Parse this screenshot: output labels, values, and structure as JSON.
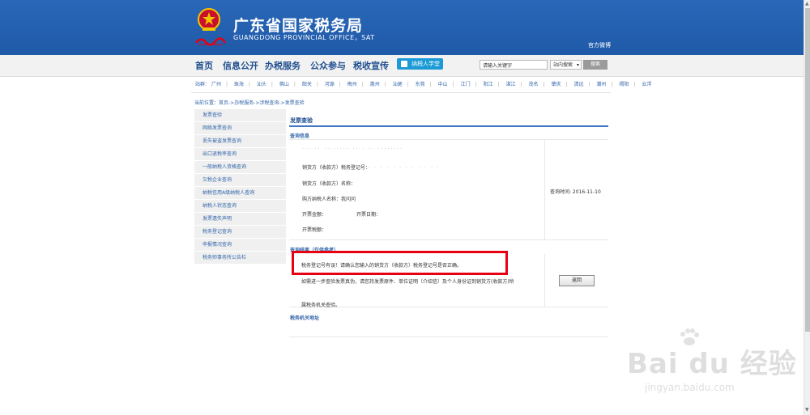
{
  "header": {
    "title_cn": "广东省国家税务局",
    "title_en": "GUANGDONG PROVINCIAL OFFICE，SAT",
    "weibo": "官方微博",
    "colors": {
      "header_bg": "#1f5aa8",
      "accent": "#3f77c0",
      "highlight": "#e60012"
    }
  },
  "nav": {
    "items": [
      "首页",
      "信息公开",
      "办税服务",
      "公众参与",
      "税收宣传"
    ],
    "classroom": "纳税人学堂",
    "search_placeholder": "请输入关键字",
    "search_scope": "站内搜索",
    "search_button": "搜索"
  },
  "cities": {
    "label": "站群：",
    "items": [
      "广州",
      "珠海",
      "汕头",
      "佛山",
      "韶关",
      "河源",
      "梅州",
      "惠州",
      "汕尾",
      "东莞",
      "中山",
      "江门",
      "阳江",
      "湛江",
      "茂名",
      "肇庆",
      "清远",
      "潮州",
      "揭阳",
      "云浮"
    ]
  },
  "breadcrumb": "当前位置：首页->办税服务->涉税查询->发票查验",
  "sidebar": {
    "items": [
      "发票查验",
      "网络发票查询",
      "丢失被盗发票查询",
      "出口退税率查询",
      "一般纳税人资格查询",
      "欠税企业查询",
      "纳税信用A级纳税人查询",
      "纳税人状态查询",
      "发票遗失声明",
      "税务登记查询",
      "申报情况查询",
      "税务师事务所公告栏"
    ]
  },
  "main": {
    "title": "发票查验",
    "query_section": "查询信息",
    "info": {
      "masked_top": "··· ·· ········  ·· · ··  ········",
      "seller_reg": "销货方（收款方）税务登记号：",
      "seller_reg_value": "· · · · · · · · · · · ·",
      "seller_name": "销货方（收款方）名称：",
      "buyer_name": "购方纳税人名称：我问问",
      "amount": "开票金额：",
      "date": "开票日期：",
      "tax": "开票税额："
    },
    "query_time": "查询时间: 2016-11-10",
    "result_section": "查询结果（仅供参考）",
    "error": "税务登记号有误！请确认您输入的销货方（收款方）税务登记号是否正确。",
    "advice": "如需进一步查验发票真伪，请您持发票原件、单位证明（介绍信）及个人身份证到销货方(收款方)所",
    "advice_2": "属税务机关查验。",
    "back_button": "返回",
    "address_section": "税务机关地址"
  },
  "watermark": {
    "brand": "Bai du 经验",
    "url": "jingyan.baidu.com"
  }
}
